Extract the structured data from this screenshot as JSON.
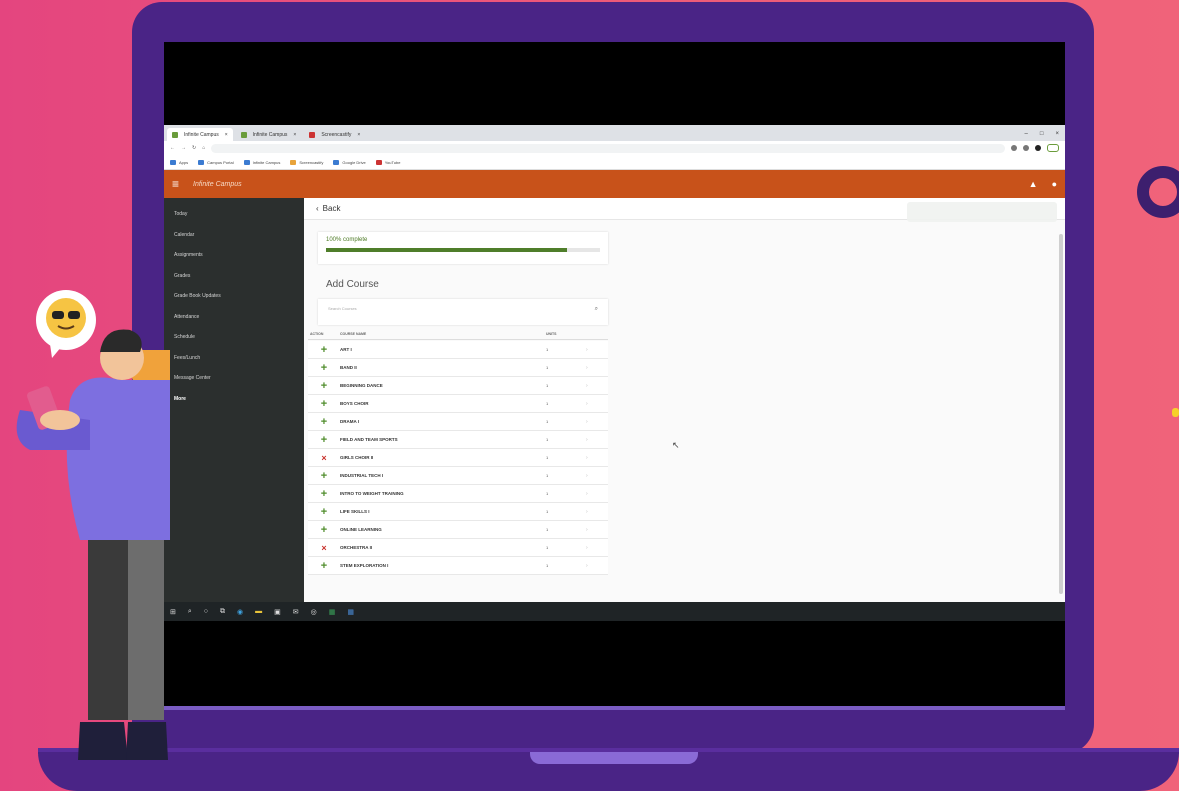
{
  "browser": {
    "tabs": [
      {
        "label": "Infinite Campus",
        "active": true
      },
      {
        "label": "Infinite Campus",
        "active": false
      },
      {
        "label": "Screencastify",
        "active": false
      }
    ],
    "url": "",
    "extension_button": "",
    "bookmarks": [
      "Apps",
      "Campus Portal",
      "Infinite Campus",
      "Screencastify",
      "Google Drive",
      "YouTube"
    ]
  },
  "app": {
    "logo": "Infinite Campus",
    "sidebar": [
      "Today",
      "Calendar",
      "Assignments",
      "Grades",
      "Grade Book Updates",
      "Attendance",
      "Schedule",
      "Fees/Lunch",
      "Message Center",
      "More"
    ],
    "active_sidebar": "More",
    "back_label": "Back",
    "progress": {
      "label": "100% complete",
      "right_text": "",
      "fraction": 0.88
    },
    "add_course_title": "Add Course",
    "search_placeholder": "Search Courses",
    "table_headers": {
      "action": "ACTION",
      "course": "COURSE NAME",
      "units": "UNITS"
    },
    "courses": [
      {
        "action": "add",
        "name": "ART I",
        "code": "",
        "badge": "",
        "units": "1"
      },
      {
        "action": "add",
        "name": "BAND II",
        "code": "",
        "badge": "",
        "units": "1"
      },
      {
        "action": "add",
        "name": "BEGINNING DANCE",
        "code": "",
        "badge": "",
        "units": "1"
      },
      {
        "action": "add",
        "name": "BOYS CHOIR",
        "code": "",
        "badge": "",
        "units": "1"
      },
      {
        "action": "add",
        "name": "DRAMA I",
        "code": "",
        "badge": "",
        "units": "1"
      },
      {
        "action": "add",
        "name": "FIELD AND TEAM SPORTS",
        "code": "",
        "badge": "",
        "units": "1"
      },
      {
        "action": "remove",
        "name": "GIRLS CHOIR II",
        "code": "",
        "badge": "",
        "units": "1"
      },
      {
        "action": "add",
        "name": "INDUSTRIAL TECH I",
        "code": "",
        "badge": "",
        "units": "1"
      },
      {
        "action": "add",
        "name": "INTRO TO WEIGHT TRAINING",
        "code": "",
        "badge": "",
        "units": "1"
      },
      {
        "action": "add",
        "name": "LIFE SKILLS I",
        "code": "",
        "badge": "",
        "units": "1"
      },
      {
        "action": "add",
        "name": "ONLINE LEARNING",
        "code": "",
        "badge": "",
        "units": "1"
      },
      {
        "action": "remove",
        "name": "ORCHESTRA II",
        "code": "",
        "badge": "",
        "units": "1"
      },
      {
        "action": "add",
        "name": "STEM EXPLORATION I",
        "code": "",
        "badge": "",
        "units": "1"
      }
    ]
  },
  "taskbar": {
    "time": "",
    "date": ""
  },
  "icons": {
    "add": "+",
    "remove": "×",
    "chevron": "›",
    "back": "‹",
    "search": "⌕",
    "menu": "≡",
    "bell": "▲",
    "user": "●",
    "cursor": "↖"
  },
  "colors": {
    "header": "#c8521a",
    "sidebar": "#2b2f2e",
    "progress": "#4f7e2a",
    "frame": "#4a2486",
    "background": "#e4457f"
  }
}
